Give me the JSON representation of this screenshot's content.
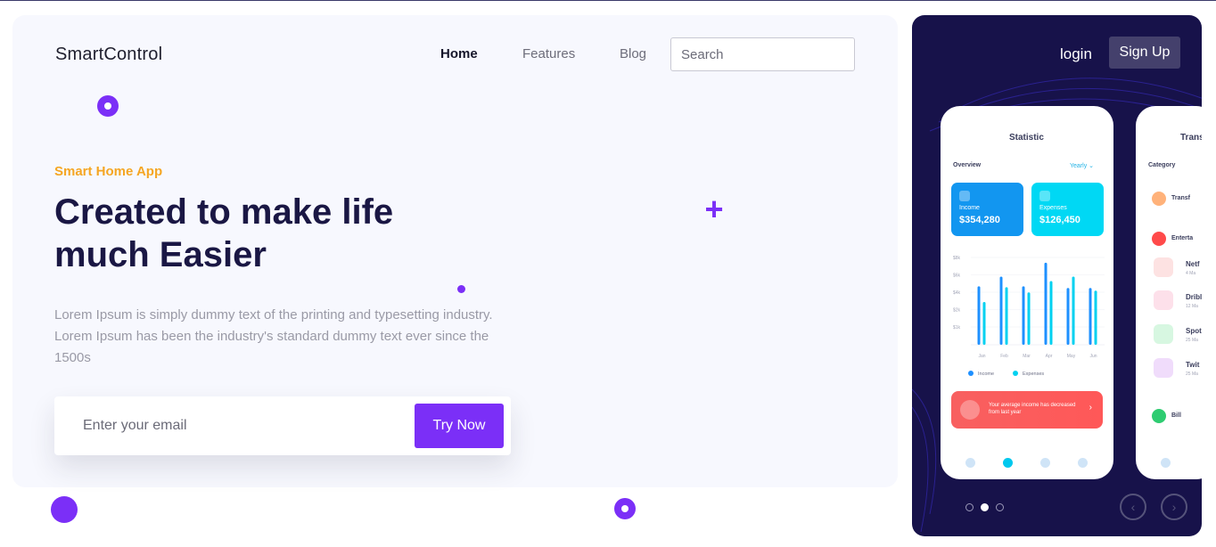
{
  "brand": "SmartControl",
  "nav": {
    "home": "Home",
    "features": "Features",
    "blog": "Blog"
  },
  "search": {
    "placeholder": "Search"
  },
  "hero": {
    "eyebrow": "Smart Home App",
    "headline": "Created to make life much Easier",
    "body": "Lorem Ipsum is simply dummy text of the printing and typesetting industry. Lorem Ipsum has been the industry's standard dummy text ever since the 1500s"
  },
  "signup_form": {
    "email_placeholder": "Enter your email",
    "button": "Try Now"
  },
  "auth": {
    "login": "login",
    "signup": "Sign Up"
  },
  "phone1": {
    "title": "Statistic",
    "overview": "Overview",
    "period": "Yearly ⌄",
    "income_label": "Income",
    "income_value": "$354,280",
    "expenses_label": "Expenses",
    "expenses_value": "$126,450",
    "chart": {
      "y_ticks": [
        "$8k",
        "$6k",
        "$4k",
        "$2k",
        "$1k"
      ],
      "months": [
        "Jan",
        "Feb",
        "Mar",
        "Apr",
        "May",
        "Jun"
      ],
      "income": [
        6.7,
        7.8,
        6.7,
        9.4,
        6.5,
        6.5
      ],
      "expenses": [
        4.9,
        6.6,
        6.0,
        7.3,
        7.8,
        6.2
      ],
      "legend": [
        "Income",
        "Expenses"
      ]
    },
    "alert": "Your average income has decreased from last year"
  },
  "phone2": {
    "title": "Trans",
    "category": "Category",
    "items": [
      "Transf",
      "Enterta",
      "Netf",
      "Dribl",
      "Spot",
      "Twit",
      "Bill"
    ],
    "subs": [
      "4 Ma",
      "12 Ma",
      "25 Ma",
      "25 Ma"
    ]
  },
  "colors": {
    "accent": "#7b2ff7",
    "orange": "#f5a623",
    "navy": "#1a1744",
    "income": "#1e90ff",
    "expenses": "#00d1f0"
  }
}
